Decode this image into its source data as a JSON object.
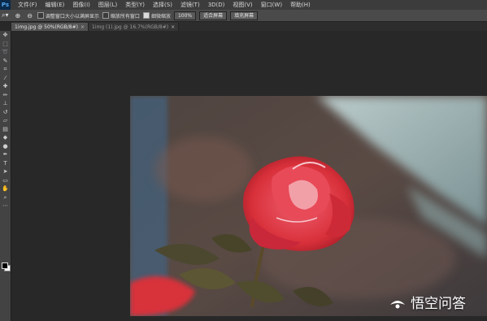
{
  "app": {
    "logo": "Ps"
  },
  "menu": [
    "文件(F)",
    "编辑(E)",
    "图像(I)",
    "图层(L)",
    "类型(Y)",
    "选择(S)",
    "滤镜(T)",
    "3D(D)",
    "视图(V)",
    "窗口(W)",
    "帮助(H)"
  ],
  "options": {
    "resize_windows": "调整窗口大小以满屏显示",
    "zoom_all": "缩放所有窗口",
    "scrubby_zoom": "细微缩放",
    "btn_100": "100%",
    "btn_fit": "适合屏幕",
    "btn_fill": "填充屏幕"
  },
  "tabs": [
    {
      "label": "1img.jpg @ 50%(RGB/8#)",
      "active": true
    },
    {
      "label": "1img (1).jpg @ 16.7%(RGB/8#)",
      "active": false
    }
  ],
  "watermark": {
    "text": "悟空问答"
  },
  "colors": {
    "menubar": "#3c3c3c",
    "options": "#4a4a4a",
    "workspace": "#282828",
    "rose": "#d8303a"
  }
}
